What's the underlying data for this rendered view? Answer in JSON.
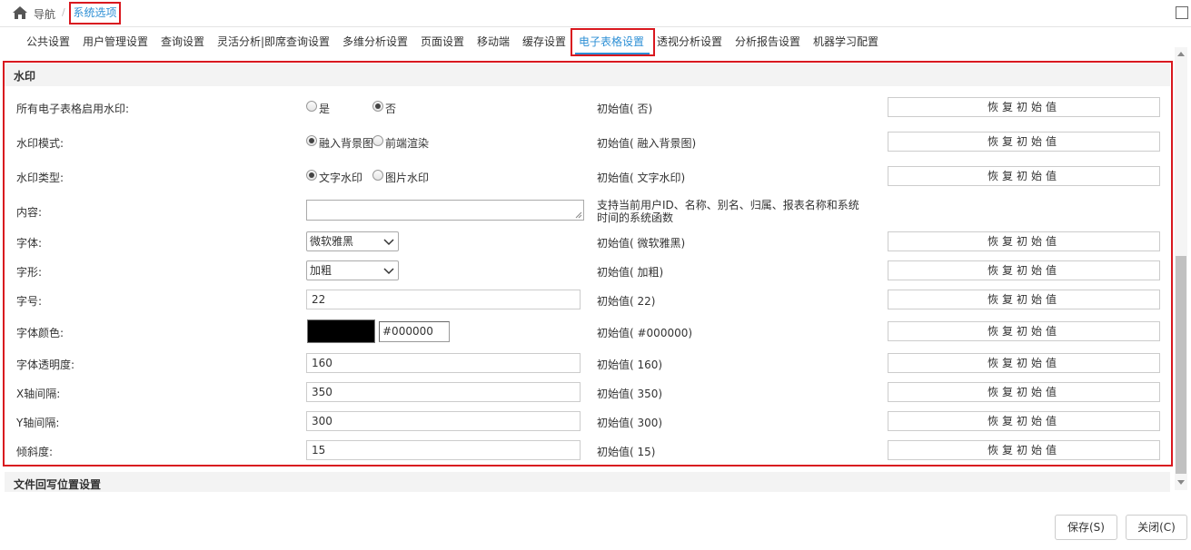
{
  "breadcrumb": {
    "nav_label": "导航",
    "separator": "/",
    "current": "系统选项"
  },
  "tabs": [
    {
      "label": "公共设置"
    },
    {
      "label": "用户管理设置"
    },
    {
      "label": "查询设置"
    },
    {
      "label": "灵活分析|即席查询设置"
    },
    {
      "label": "多维分析设置"
    },
    {
      "label": "页面设置"
    },
    {
      "label": "移动端"
    },
    {
      "label": "缓存设置"
    },
    {
      "label": "电子表格设置"
    },
    {
      "label": "透视分析设置"
    },
    {
      "label": "分析报告设置"
    },
    {
      "label": "机器学习配置"
    }
  ],
  "active_tab": "电子表格设置",
  "section": {
    "title": "水印"
  },
  "restore_label": "恢复初始值",
  "rows": {
    "enable": {
      "label": "所有电子表格启用水印:",
      "options": [
        "是",
        "否"
      ],
      "selected": "否",
      "initial": "初始值( 否)"
    },
    "mode": {
      "label": "水印模式:",
      "options": [
        "融入背景图",
        "前端渲染"
      ],
      "selected": "融入背景图",
      "initial": "初始值( 融入背景图)"
    },
    "type": {
      "label": "水印类型:",
      "options": [
        "文字水印",
        "图片水印"
      ],
      "selected": "文字水印",
      "initial": "初始值( 文字水印)"
    },
    "content": {
      "label": "内容:",
      "value": "",
      "help": "支持当前用户ID、名称、别名、归属、报表名称和系统时间的系统函数"
    },
    "font": {
      "label": "字体:",
      "value": "微软雅黑",
      "initial": "初始值( 微软雅黑)"
    },
    "style": {
      "label": "字形:",
      "value": "加粗",
      "initial": "初始值( 加粗)"
    },
    "size": {
      "label": "字号:",
      "value": "22",
      "initial": "初始值( 22)"
    },
    "color": {
      "label": "字体颜色:",
      "value": "#000000",
      "initial": "初始值( #000000)"
    },
    "opacity": {
      "label": "字体透明度:",
      "value": "160",
      "initial": "初始值( 160)"
    },
    "x_spacing": {
      "label": "X轴间隔:",
      "value": "350",
      "initial": "初始值( 350)"
    },
    "y_spacing": {
      "label": "Y轴间隔:",
      "value": "300",
      "initial": "初始值( 300)"
    },
    "slant": {
      "label": "倾斜度:",
      "value": "15",
      "initial": "初始值( 15)"
    }
  },
  "section2": {
    "title": "文件回写位置设置"
  },
  "footer": {
    "save_label": "保存(S)",
    "close_label": "关闭(C)"
  },
  "colors": {
    "accent": "#2d8fd5",
    "highlight": "#d9181f",
    "swatch": "#000000"
  }
}
